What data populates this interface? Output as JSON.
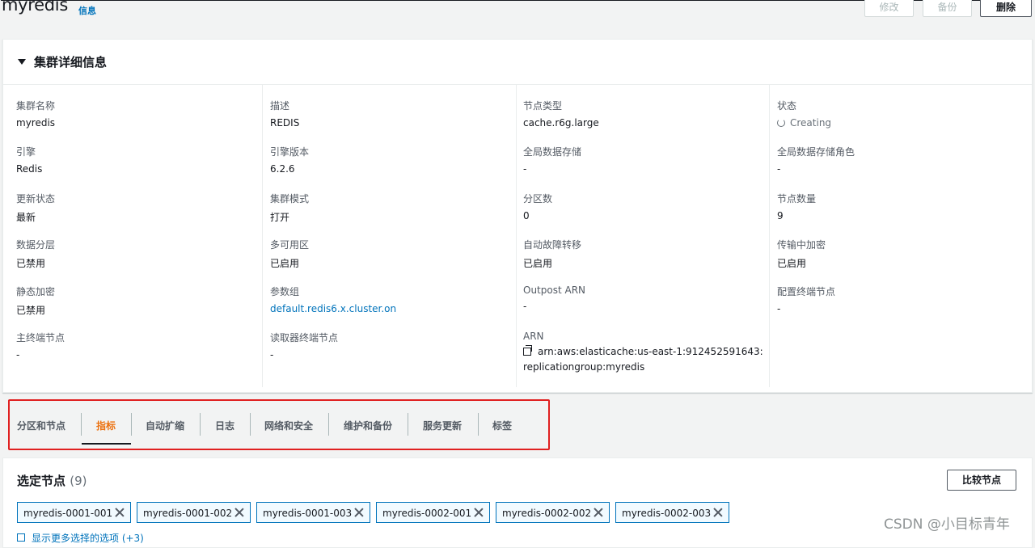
{
  "header": {
    "title": "myredis",
    "info_link": "信息",
    "buttons": {
      "edit": "修改",
      "backup": "备份",
      "delete": "删除"
    }
  },
  "cluster_details": {
    "section_title": "集群详细信息",
    "columns": [
      [
        {
          "label": "集群名称",
          "value": "myredis"
        },
        {
          "label": "引擎",
          "value": "Redis"
        },
        {
          "label": "更新状态",
          "value": "最新"
        },
        {
          "label": "数据分层",
          "value": "已禁用"
        },
        {
          "label": "静态加密",
          "value": "已禁用"
        },
        {
          "label": "主终端节点",
          "value": "-"
        }
      ],
      [
        {
          "label": "描述",
          "value": "REDIS"
        },
        {
          "label": "引擎版本",
          "value": "6.2.6"
        },
        {
          "label": "集群模式",
          "value": "打开"
        },
        {
          "label": "多可用区",
          "value": "已启用"
        },
        {
          "label": "参数组",
          "value": "default.redis6.x.cluster.on"
        },
        {
          "label": "读取器终端节点",
          "value": "-"
        }
      ],
      [
        {
          "label": "节点类型",
          "value": "cache.r6g.large"
        },
        {
          "label": "全局数据存储",
          "value": "-"
        },
        {
          "label": "分区数",
          "value": "0"
        },
        {
          "label": "自动故障转移",
          "value": "已启用"
        },
        {
          "label": "Outpost ARN",
          "value": "-"
        },
        {
          "label": "ARN",
          "value": "arn:aws:elasticache:us-east-1:912452591643:replicationgroup:myredis"
        }
      ],
      [
        {
          "label": "状态",
          "value": "Creating"
        },
        {
          "label": "全局数据存储角色",
          "value": "-"
        },
        {
          "label": "节点数量",
          "value": "9"
        },
        {
          "label": "传输中加密",
          "value": "已启用"
        },
        {
          "label": "配置终端节点",
          "value": "-"
        }
      ]
    ]
  },
  "tabs": [
    {
      "label": "分区和节点",
      "active": false
    },
    {
      "label": "指标",
      "active": true
    },
    {
      "label": "自动扩缩",
      "active": false
    },
    {
      "label": "日志",
      "active": false
    },
    {
      "label": "网络和安全",
      "active": false
    },
    {
      "label": "维护和备份",
      "active": false
    },
    {
      "label": "服务更新",
      "active": false
    },
    {
      "label": "标签",
      "active": false
    }
  ],
  "selected_nodes": {
    "title": "选定节点",
    "count": "(9)",
    "compare_button": "比较节点",
    "tokens": [
      "myredis-0001-001",
      "myredis-0001-002",
      "myredis-0001-003",
      "myredis-0002-001",
      "myredis-0002-002",
      "myredis-0002-003"
    ],
    "more_options": "显示更多选择的选项 (+3)"
  },
  "watermark": "CSDN @小目标青年",
  "colors": {
    "link": "#0073bb",
    "active_tab": "#ec7211",
    "highlight_box": "#e02020"
  }
}
